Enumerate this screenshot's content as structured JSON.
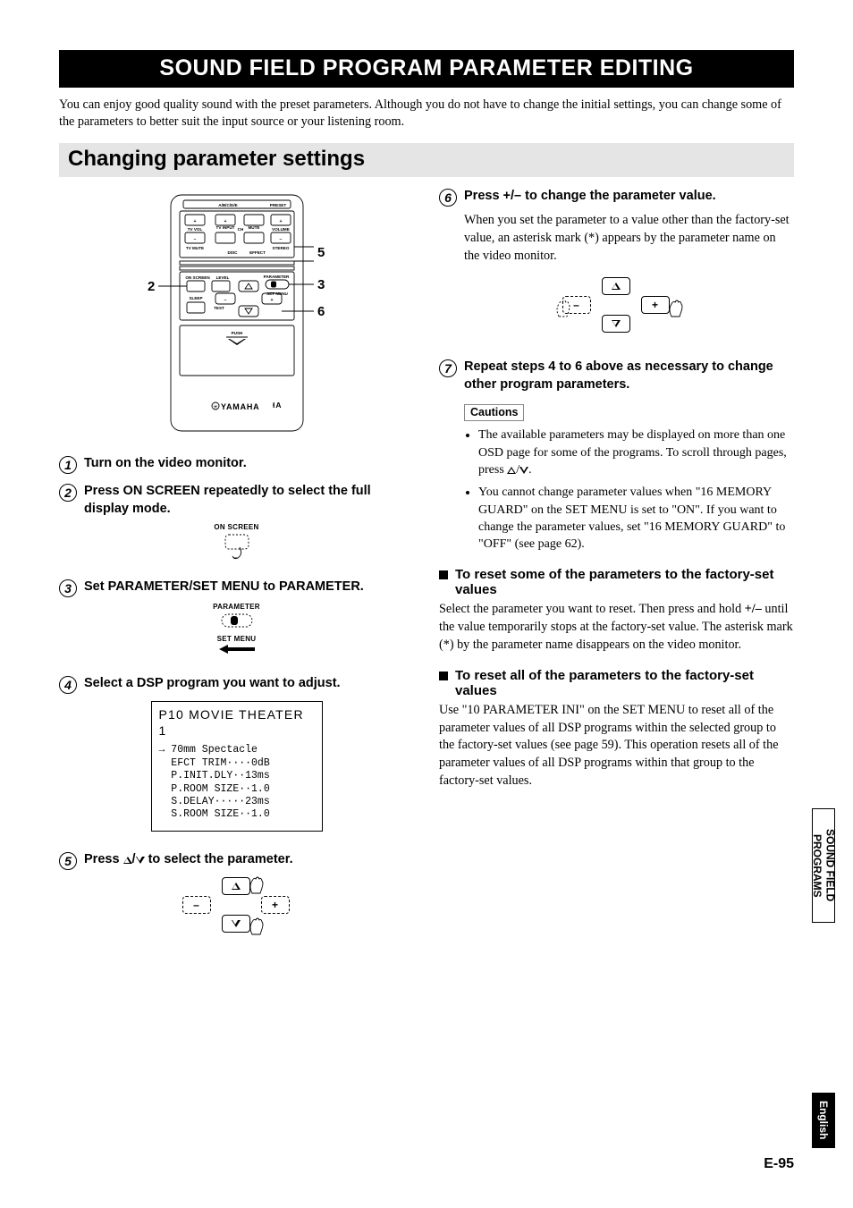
{
  "banner": "SOUND FIELD PROGRAM PARAMETER EDITING",
  "intro": "You can enjoy good quality sound with the preset parameters. Although you do not have to change the initial settings, you can change some of the parameters to better suit the input source or your listening room.",
  "section": "Changing parameter settings",
  "remote": {
    "brand": "YAMAHA",
    "rows": {
      "abcde": "A/B/C/D/E",
      "preset": "PRESET",
      "tvvol": "TV VOL",
      "tvinput": "TV INPUT",
      "ch": "CH",
      "mute": "MUTE",
      "volume": "VOLUME",
      "tvmute": "TV MUTE",
      "disc": "DISC",
      "effect": "EFFECT",
      "stereo": "STEREO",
      "onscreen": "ON SCREEN",
      "level": "LEVEL",
      "parameter": "PARAMETER",
      "setmenu": "SET MENU",
      "sleep": "SLEEP",
      "test": "TEST",
      "push": "PUSH"
    },
    "callouts": {
      "c2": "2",
      "c3": "3",
      "c5": "5",
      "c6": "6"
    }
  },
  "steps": {
    "s1": {
      "head": "Turn on the video monitor."
    },
    "s2": {
      "head": "Press ON SCREEN repeatedly to select the full display mode.",
      "label": "ON SCREEN"
    },
    "s3": {
      "head": "Set PARAMETER/SET MENU to PARAMETER.",
      "top": "PARAMETER",
      "bottom": "SET MENU"
    },
    "s4": {
      "head": "Select a DSP program you want to adjust."
    },
    "s5": {
      "head_pre": "Press ",
      "head_post": " to select the parameter."
    },
    "s6": {
      "head": "Press +/– to change the parameter value.",
      "body": "When you set the parameter to a value other than the factory-set value, an asterisk mark (*) appears by the parameter name on the video monitor."
    },
    "s7": {
      "head": "Repeat steps 4 to 6 above as necessary to change other program parameters."
    }
  },
  "osd": {
    "title": "P10 MOVIE THEATER 1",
    "lines": [
      "→ 70mm Spectacle",
      "  EFCT TRIM····0dB",
      "  P.INIT.DLY··13ms",
      "  P.ROOM SIZE··1.0",
      "  S.DELAY·····23ms",
      "  S.ROOM SIZE··1.0"
    ]
  },
  "cautions": {
    "label": "Cautions",
    "items": [
      {
        "pre": "The available parameters may be displayed on more than one OSD page for some of the programs. To scroll through pages, press ",
        "post": "."
      },
      {
        "text": "You cannot change parameter values when \"16 MEMORY GUARD\" on the SET MENU is set to \"ON\". If you want to change the parameter values, set \"16 MEMORY GUARD\" to \"OFF\" (see page 62)."
      }
    ]
  },
  "sub1": {
    "title": "To reset some of the parameters to the factory-set values",
    "body_pre": "Select the parameter you want to reset. Then press and hold ",
    "body_bold": "+/–",
    "body_post": " until the value temporarily stops at the factory-set value. The asterisk mark (*) by the parameter name disappears on the video monitor."
  },
  "sub2": {
    "title": "To reset all of the parameters to the factory-set values",
    "body": "Use \"10 PARAMETER INI\" on the SET MENU to reset all of the parameter values of all DSP programs within the selected group to the factory-set values (see page 59). This operation resets all of the parameter values of all DSP programs within that group to the factory-set values."
  },
  "sidetab_sf_line1": "SOUND FIELD",
  "sidetab_sf_line2": "PROGRAMS",
  "sidetab_en": "English",
  "pageno": "E-95"
}
